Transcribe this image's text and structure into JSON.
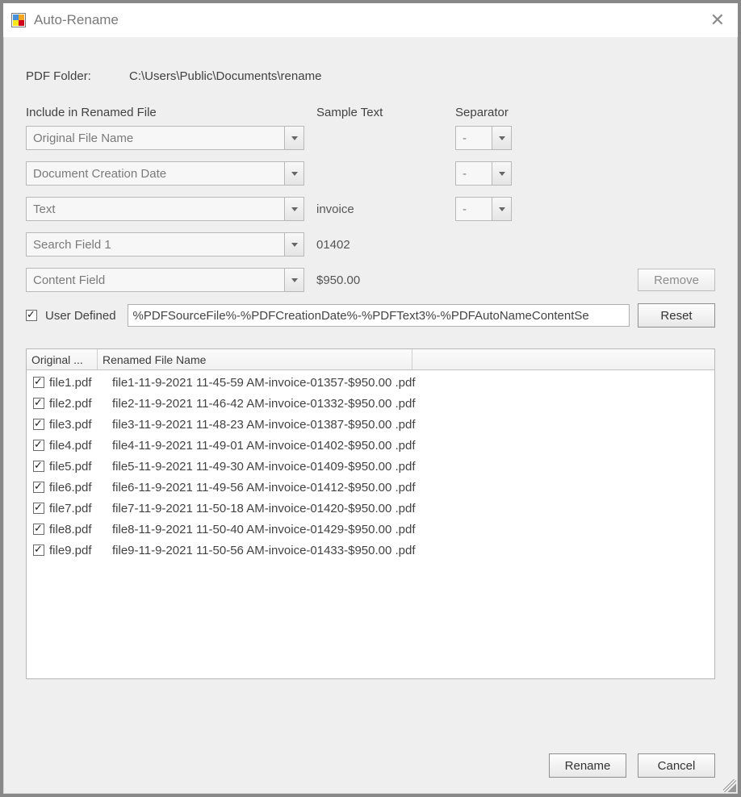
{
  "window": {
    "title": "Auto-Rename"
  },
  "folder": {
    "label": "PDF Folder:",
    "value": "C:\\Users\\Public\\Documents\\rename"
  },
  "headers": {
    "include": "Include in Renamed File",
    "sample": "Sample Text",
    "separator": "Separator"
  },
  "rows": [
    {
      "include": "Original File Name",
      "sample": "",
      "sep": "-"
    },
    {
      "include": "Document Creation Date",
      "sample": "",
      "sep": "-"
    },
    {
      "include": "Text",
      "sample": "invoice",
      "sep": "-"
    },
    {
      "include": "Search Field 1",
      "sample": "01402",
      "sep": null
    },
    {
      "include": "Content Field",
      "sample": "$950.00",
      "sep": null
    }
  ],
  "remove_btn": "Remove",
  "user_defined_label": "User Defined",
  "user_defined_value": "%PDFSourceFile%-%PDFCreationDate%-%PDFText3%-%PDFAutoNameContentSe",
  "reset_btn": "Reset",
  "table": {
    "col1": "Original ...",
    "col2": "Renamed File Name",
    "rows": [
      {
        "orig": "file1.pdf",
        "renamed": "file1-11-9-2021 11-45-59 AM-invoice-01357-$950.00 .pdf"
      },
      {
        "orig": "file2.pdf",
        "renamed": "file2-11-9-2021 11-46-42 AM-invoice-01332-$950.00 .pdf"
      },
      {
        "orig": "file3.pdf",
        "renamed": "file3-11-9-2021 11-48-23 AM-invoice-01387-$950.00 .pdf"
      },
      {
        "orig": "file4.pdf",
        "renamed": "file4-11-9-2021 11-49-01 AM-invoice-01402-$950.00 .pdf"
      },
      {
        "orig": "file5.pdf",
        "renamed": "file5-11-9-2021 11-49-30 AM-invoice-01409-$950.00 .pdf"
      },
      {
        "orig": "file6.pdf",
        "renamed": "file6-11-9-2021 11-49-56 AM-invoice-01412-$950.00 .pdf"
      },
      {
        "orig": "file7.pdf",
        "renamed": "file7-11-9-2021 11-50-18 AM-invoice-01420-$950.00 .pdf"
      },
      {
        "orig": "file8.pdf",
        "renamed": "file8-11-9-2021 11-50-40 AM-invoice-01429-$950.00 .pdf"
      },
      {
        "orig": "file9.pdf",
        "renamed": "file9-11-9-2021 11-50-56 AM-invoice-01433-$950.00 .pdf"
      }
    ]
  },
  "buttons": {
    "rename": "Rename",
    "cancel": "Cancel"
  }
}
